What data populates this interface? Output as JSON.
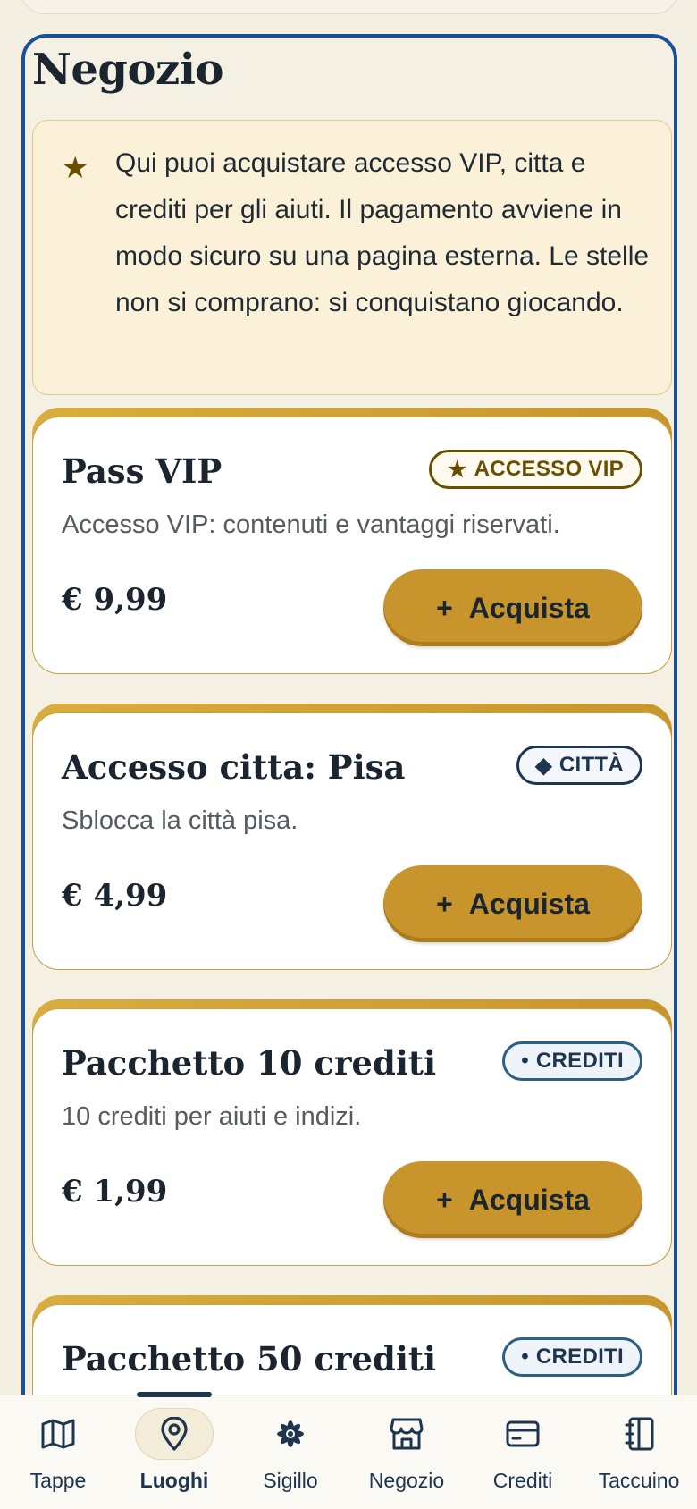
{
  "page": {
    "title": "Negozio",
    "notice": {
      "icon": "star-icon",
      "text": "Qui puoi acquistare accesso VIP, citta e crediti per gli aiuti. Il pagamento avviene in modo sicuro su una pagina esterna. Le stelle non si comprano: si conquistano giocando."
    }
  },
  "products": [
    {
      "title": "Pass VIP",
      "badge_symbol": "★",
      "badge": "ACCESSO VIP",
      "description": "Accesso VIP: contenuti e vantaggi riservati.",
      "price": "€ 9,99",
      "button_label": "Acquista"
    },
    {
      "title": "Accesso citta: Pisa",
      "badge_symbol": "◆",
      "badge": "CITTÀ",
      "description": "Sblocca la città pisa.",
      "price": "€ 4,99",
      "button_label": "Acquista"
    },
    {
      "title": "Pacchetto 10 crediti",
      "badge_symbol": "•",
      "badge": "CREDITI",
      "description": "10 crediti per aiuti e indizi.",
      "price": "€ 1,99",
      "button_label": "Acquista"
    },
    {
      "title": "Pacchetto 50 crediti",
      "badge_symbol": "•",
      "badge": "CREDITI"
    }
  ],
  "bottom_nav": [
    {
      "label": "Tappe",
      "icon": "map-icon",
      "active": false
    },
    {
      "label": "Luoghi",
      "icon": "location-pin-icon",
      "active": true
    },
    {
      "label": "Sigillo",
      "icon": "seal-icon",
      "active": false
    },
    {
      "label": "Negozio",
      "icon": "store-icon",
      "active": false
    },
    {
      "label": "Crediti",
      "icon": "credit-card-icon",
      "active": false
    },
    {
      "label": "Taccuino",
      "icon": "notebook-icon",
      "active": false
    }
  ],
  "colors": {
    "accent_gold": "#c8952c",
    "frame_blue": "#1a4f9c",
    "ink": "#1e3550"
  }
}
